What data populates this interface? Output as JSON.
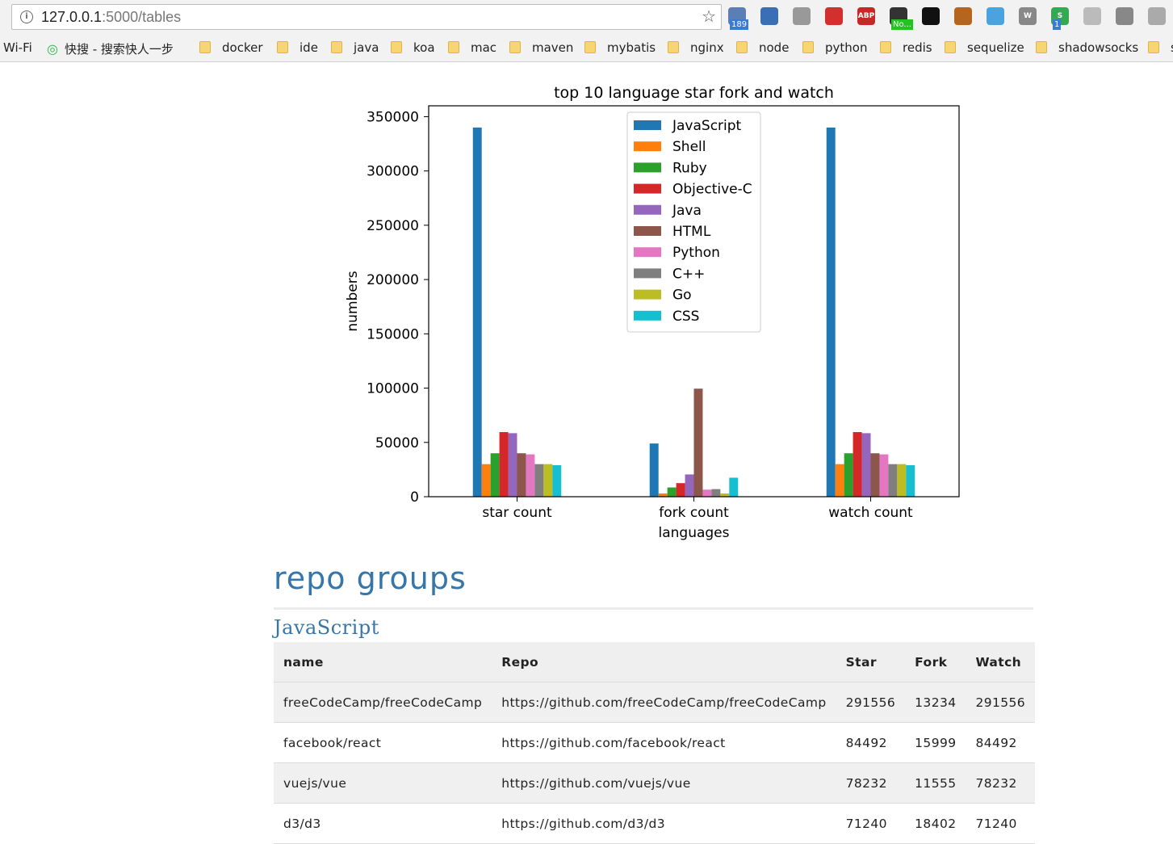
{
  "browser": {
    "url_host": "127.0.0.1",
    "url_rest": ":5000/tables",
    "extensions": [
      {
        "icon": "mail-icon",
        "badge": "189",
        "color": "#5b7fb5"
      },
      {
        "icon": "translate-icon",
        "color": "#3a6fb5"
      },
      {
        "icon": "sitemap-icon",
        "color": "#999999"
      },
      {
        "icon": "dots-icon",
        "color": "#d32f2f"
      },
      {
        "icon": "adblock-icon",
        "label": "ABP",
        "color": "#c62828"
      },
      {
        "icon": "power-icon",
        "badge": "No...",
        "color": "#333333"
      },
      {
        "icon": "octocat-icon",
        "color": "#111111"
      },
      {
        "icon": "monkey-icon",
        "color": "#b5651d"
      },
      {
        "icon": "check-icon",
        "color": "#4aa3df"
      },
      {
        "icon": "wiki-icon",
        "label": "W",
        "color": "#888888"
      },
      {
        "icon": "s-icon",
        "label": "S",
        "badge": "1",
        "color": "#34a853"
      },
      {
        "icon": "paper-icon",
        "color": "#bbbbbb"
      },
      {
        "icon": "globe-icon",
        "color": "#888888"
      },
      {
        "icon": "target-icon",
        "color": "#aaaaaa"
      }
    ],
    "bookmarks": [
      {
        "label": "Wi-Fi",
        "type": "plain"
      },
      {
        "label": "快搜 - 搜索快人一步",
        "type": "site"
      },
      {
        "label": "docker",
        "type": "folder"
      },
      {
        "label": "ide",
        "type": "folder"
      },
      {
        "label": "java",
        "type": "folder"
      },
      {
        "label": "koa",
        "type": "folder"
      },
      {
        "label": "mac",
        "type": "folder"
      },
      {
        "label": "maven",
        "type": "folder"
      },
      {
        "label": "mybatis",
        "type": "folder"
      },
      {
        "label": "nginx",
        "type": "folder"
      },
      {
        "label": "node",
        "type": "folder"
      },
      {
        "label": "python",
        "type": "folder"
      },
      {
        "label": "redis",
        "type": "folder"
      },
      {
        "label": "sequelize",
        "type": "folder"
      },
      {
        "label": "shadowsocks",
        "type": "folder"
      },
      {
        "label": "s",
        "type": "folder"
      }
    ]
  },
  "chart_data": {
    "type": "bar",
    "title": "top 10 language star fork and watch",
    "xlabel": "languages",
    "ylabel": "numbers",
    "categories": [
      "star count",
      "fork count",
      "watch count"
    ],
    "ylim": [
      0,
      360000
    ],
    "yticks": [
      0,
      50000,
      100000,
      150000,
      200000,
      250000,
      300000,
      350000
    ],
    "legend_position": "top-center",
    "grid": false,
    "series": [
      {
        "name": "JavaScript",
        "color": "#1f77b4",
        "values": [
          340000,
          49000,
          340000
        ]
      },
      {
        "name": "Shell",
        "color": "#ff7f0e",
        "values": [
          30000,
          3000,
          30000
        ]
      },
      {
        "name": "Ruby",
        "color": "#2ca02c",
        "values": [
          40000,
          8500,
          40000
        ]
      },
      {
        "name": "Objective-C",
        "color": "#d62728",
        "values": [
          59500,
          12500,
          59500
        ]
      },
      {
        "name": "Java",
        "color": "#9467bd",
        "values": [
          58500,
          20500,
          58500
        ]
      },
      {
        "name": "HTML",
        "color": "#8c564b",
        "values": [
          40000,
          99500,
          40000
        ]
      },
      {
        "name": "Python",
        "color": "#e377c2",
        "values": [
          39000,
          6500,
          39000
        ]
      },
      {
        "name": "C++",
        "color": "#7f7f7f",
        "values": [
          30000,
          7000,
          30000
        ]
      },
      {
        "name": "Go",
        "color": "#bcbd22",
        "values": [
          30000,
          3000,
          30000
        ]
      },
      {
        "name": "CSS",
        "color": "#17becf",
        "values": [
          29000,
          17500,
          29000
        ]
      }
    ]
  },
  "repo": {
    "heading": "repo groups",
    "group": "JavaScript",
    "columns": [
      "name",
      "Repo",
      "Star",
      "Fork",
      "Watch"
    ],
    "rows": [
      [
        "freeCodeCamp/freeCodeCamp",
        "https://github.com/freeCodeCamp/freeCodeCamp",
        "291556",
        "13234",
        "291556"
      ],
      [
        "facebook/react",
        "https://github.com/facebook/react",
        "84492",
        "15999",
        "84492"
      ],
      [
        "vuejs/vue",
        "https://github.com/vuejs/vue",
        "78232",
        "11555",
        "78232"
      ],
      [
        "d3/d3",
        "https://github.com/d3/d3",
        "71240",
        "18402",
        "71240"
      ]
    ]
  }
}
